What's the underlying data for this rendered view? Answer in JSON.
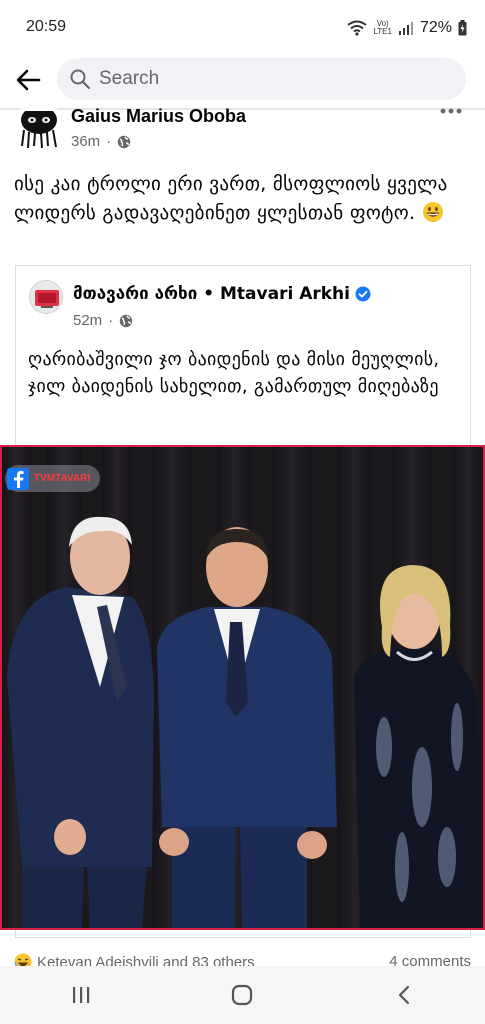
{
  "status_bar": {
    "time": "20:59",
    "network_top": "Vo)",
    "network_bottom": "LTE1",
    "battery": "72%"
  },
  "search": {
    "placeholder": "Search"
  },
  "post": {
    "author": "Gaius Marius Oboba",
    "time": "36m",
    "privacy_icon": "globe-icon",
    "text": "ისე კაი ტროლი ერი ვართ, მსოფლიოს ყველა ლიდერს  გადავაღებინეთ ყლესთან ფოტო.",
    "emoji": "grinning-face-emoji"
  },
  "shared_post": {
    "page_name": "მთავარი არხი • Mtavari Arkhi",
    "verified": true,
    "time": "52m",
    "text": "ღარიბაშვილი ჯო ბაიდენის და მისი მეუღლის, ჯილ ბაიდენის სახელით, გამართულ მიღებაზე"
  },
  "photo": {
    "watermark": "TVMTAVARI"
  },
  "engagement": {
    "reactions": "Ketevan Adeishvili and 83 others",
    "comments": "4 comments"
  },
  "colors": {
    "accent_blue": "#1877f2",
    "photo_border": "#d81e4a"
  }
}
